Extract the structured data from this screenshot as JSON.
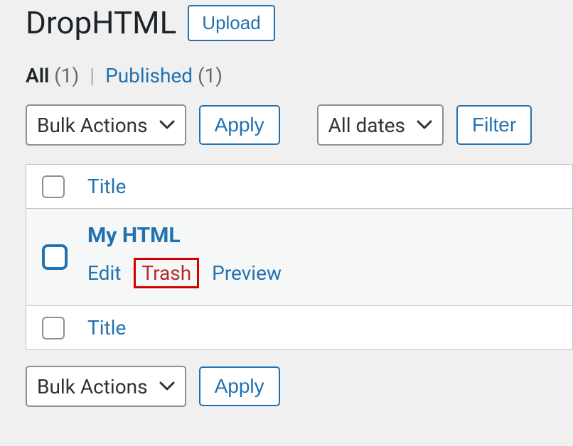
{
  "header": {
    "title": "DropHTML",
    "upload_label": "Upload"
  },
  "filters": {
    "all_label": "All",
    "all_count": "(1)",
    "separator": "|",
    "published_label": "Published",
    "published_count": "(1)"
  },
  "bulk": {
    "actions_label": "Bulk Actions",
    "apply_label": "Apply"
  },
  "dates": {
    "label": "All dates",
    "filter_label": "Filter"
  },
  "table": {
    "column_title": "Title",
    "rows": [
      {
        "title": "My HTML",
        "actions": {
          "edit": "Edit",
          "trash": "Trash",
          "preview": "Preview"
        }
      }
    ]
  }
}
